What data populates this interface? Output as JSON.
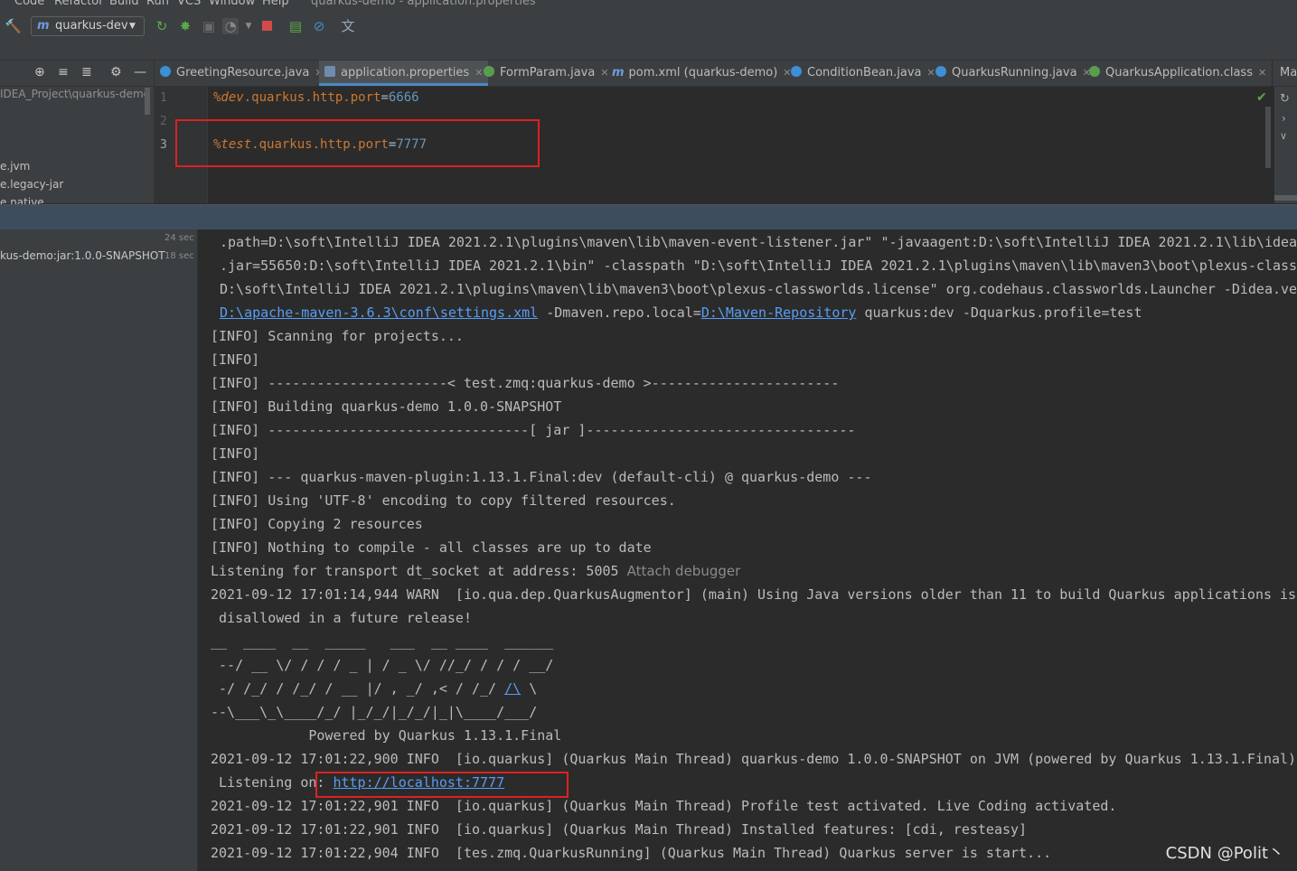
{
  "menu": {
    "items": [
      "Code",
      "Refactor",
      "Build",
      "Run",
      "VCS",
      "Window",
      "Help"
    ],
    "title": "quarkus-demo - application.properties"
  },
  "toolbar": {
    "run_config": "quarkus-dev",
    "icons": [
      "hammer-icon",
      "reload-icon",
      "debug-icon",
      "coverage-icon",
      "profile-icon",
      "stop-icon",
      "build-icon",
      "no-icon",
      "translate-icon"
    ]
  },
  "project": {
    "path": "IDEA_Project\\quarkus-demo",
    "items": [
      "e.jvm",
      "e.legacy-jar",
      "e.native"
    ]
  },
  "tabs": [
    {
      "label": "GreetingResource.java",
      "icon_color": "#3d8fd6",
      "active": false
    },
    {
      "label": "application.properties",
      "icon_color": "#6f8cb0",
      "active": true
    },
    {
      "label": "FormParam.java",
      "icon_color": "#5a9e4d",
      "active": false
    },
    {
      "label": "pom.xml (quarkus-demo)",
      "icon_color": "#6e9ce0",
      "active": false
    },
    {
      "label": "ConditionBean.java",
      "icon_color": "#3d8fd6",
      "active": false
    },
    {
      "label": "QuarkusRunning.java",
      "icon_color": "#3d8fd6",
      "active": false
    },
    {
      "label": "QuarkusApplication.class",
      "icon_color": "#5a9e4d",
      "active": false
    },
    {
      "label": "Ma",
      "icon_color": "",
      "active": false
    }
  ],
  "editor": {
    "lines": [
      {
        "num": "1",
        "profile": "%dev",
        "key": ".quarkus.http.port",
        "eq": "=",
        "value": "6666"
      },
      {
        "num": "2",
        "profile": "",
        "key": "",
        "eq": "",
        "value": ""
      },
      {
        "num": "3",
        "profile": "%test",
        "key": ".quarkus.http.port",
        "eq": "=",
        "value": "7777"
      }
    ]
  },
  "run_tree": {
    "time_top": "24 sec",
    "item": "kus-demo:jar:1.0.0-SNAPSHOT",
    "item_time": "18 sec"
  },
  "console": {
    "cmd_lines": [
      ".path=D:\\soft\\IntelliJ IDEA 2021.2.1\\plugins\\maven\\lib\\maven-event-listener.jar\" \"-javaagent:D:\\soft\\IntelliJ IDEA 2021.2.1\\lib\\idea_",
      ".jar=55650:D:\\soft\\IntelliJ IDEA 2021.2.1\\bin\" -classpath \"D:\\soft\\IntelliJ IDEA 2021.2.1\\plugins\\maven\\lib\\maven3\\boot\\plexus-classw",
      "D:\\soft\\IntelliJ IDEA 2021.2.1\\plugins\\maven\\lib\\maven3\\boot\\plexus-classworlds.license\" org.codehaus.classworlds.Launcher -Didea.ver"
    ],
    "settings_link": "D:\\apache-maven-3.6.3\\conf\\settings.xml",
    "repo_prefix": " -Dmaven.repo.local=",
    "repo_link": "D:\\Maven-Repository",
    "cmd_suffix": " quarkus:dev -Dquarkus.profile=test",
    "info_lines": [
      "[INFO] Scanning for projects...",
      "[INFO]",
      "[INFO] ----------------------< test.zmq:quarkus-demo >-----------------------",
      "[INFO] Building quarkus-demo 1.0.0-SNAPSHOT",
      "[INFO] --------------------------------[ jar ]---------------------------------",
      "[INFO]",
      "[INFO] --- quarkus-maven-plugin:1.13.1.Final:dev (default-cli) @ quarkus-demo ---",
      "[INFO] Using 'UTF-8' encoding to copy filtered resources.",
      "[INFO] Copying 2 resources",
      "[INFO] Nothing to compile - all classes are up to date"
    ],
    "listening_transport": "Listening for transport dt_socket at address: 5005",
    "attach_debugger": "Attach debugger",
    "warn_line": "2021-09-12 17:01:14,944 WARN  [io.qua.dep.QuarkusAugmentor] (main) Using Java versions older than 11 to build Quarkus applications is",
    "warn_cont": " disallowed in a future release!",
    "banner": [
      "__  ____  __  _____   ___  __ ____  ______ ",
      " --/ __ \\/ / / / _ | / _ \\/ //_/ / / / __/ ",
      " -/ /_/ / /_/ / __ |/ , _/ ,< / /_/ ",
      "--\\___\\_\\____/_/ |_/_/|_/_/|_|\\____/___/   "
    ],
    "banner_link": "/\\",
    "banner_tail": " \\",
    "powered_by": "            Powered by Quarkus 1.13.1.Final",
    "started_line": "2021-09-12 17:01:22,900 INFO  [io.quarkus] (Quarkus Main Thread) quarkus-demo 1.0.0-SNAPSHOT on JVM (powered by Quarkus 1.13.1.Final)",
    "listening_prefix": " Listening on: ",
    "listening_url": "http://localhost:7777",
    "profile_line": "2021-09-12 17:01:22,901 INFO  [io.quarkus] (Quarkus Main Thread) Profile test activated. Live Coding activated.",
    "features_line": "2021-09-12 17:01:22,901 INFO  [io.quarkus] (Quarkus Main Thread) Installed features: [cdi, resteasy]",
    "start_line": "2021-09-12 17:01:22,904 INFO  [tes.zmq.QuarkusRunning] (Quarkus Main Thread) Quarkus server is start..."
  },
  "watermark": "CSDN @Polit丶"
}
